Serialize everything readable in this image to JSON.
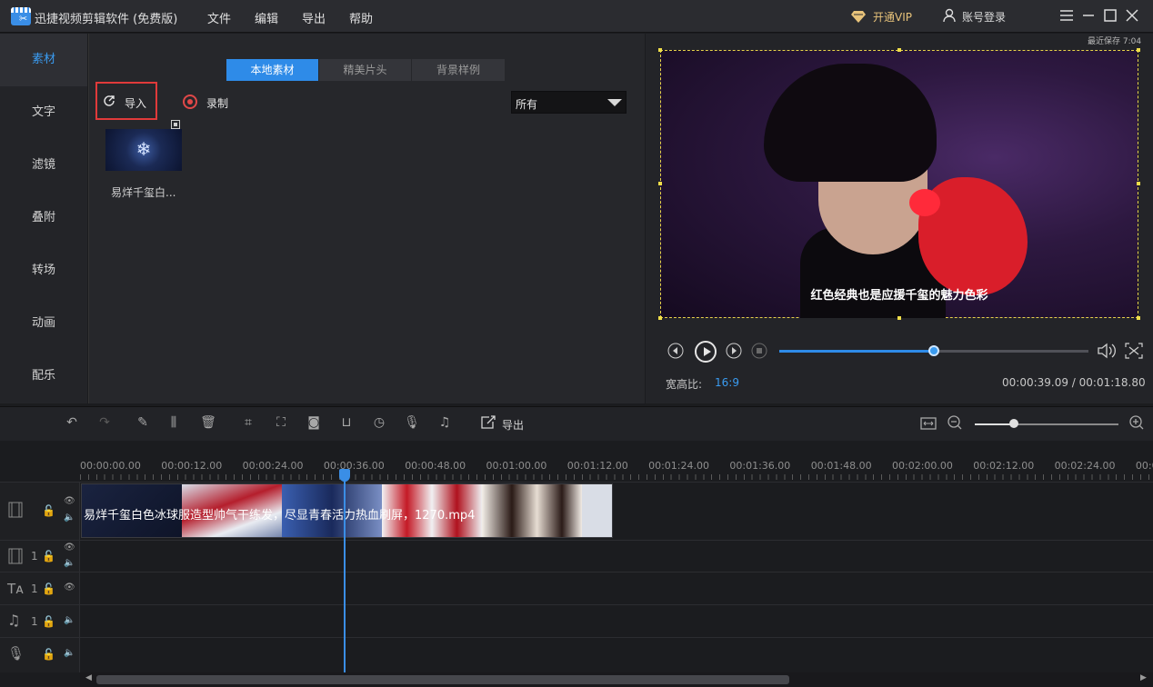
{
  "app": {
    "title": "迅捷视频剪辑软件 (免费版)"
  },
  "menu": [
    "文件",
    "编辑",
    "导出",
    "帮助"
  ],
  "account": {
    "vip_label": "开通VIP",
    "login_label": "账号登录"
  },
  "sidebar": {
    "items": [
      {
        "label": "素材",
        "active": true
      },
      {
        "label": "文字"
      },
      {
        "label": "滤镜"
      },
      {
        "label": "叠附"
      },
      {
        "label": "转场"
      },
      {
        "label": "动画"
      },
      {
        "label": "配乐"
      }
    ]
  },
  "media": {
    "tabs": [
      "本地素材",
      "精美片头",
      "背景样例"
    ],
    "import_label": "导入",
    "record_label": "录制",
    "filter_value": "所有",
    "items": [
      {
        "label": "易烊千玺白..."
      }
    ]
  },
  "preview": {
    "last_save": "最近保存 7:04",
    "subtitle": "红色经典也是应援千玺的魅力色彩",
    "aspect_label": "宽高比:",
    "aspect_value": "16:9",
    "timecode": "00:00:39.09 / 00:01:18.80",
    "progress": 0.5
  },
  "toolbar": {
    "export_label": "导出",
    "zoom": 0.27
  },
  "ruler": {
    "labels": [
      "00:00:00.00",
      "00:00:12.00",
      "00:00:24.00",
      "00:00:36.00",
      "00:00:48.00",
      "00:01:00.00",
      "00:01:12.00",
      "00:01:24.00",
      "00:01:36.00",
      "00:01:48.00",
      "00:02:00.00",
      "00:02:12.00",
      "00:02:24.00",
      "00:0"
    ]
  },
  "timeline": {
    "clip_label": "易烊千玺白色冰球服造型帅气干练发，尽显青春活力热血刷屏，1270.mp4",
    "track_numbers": [
      "1",
      "1",
      "1"
    ]
  }
}
